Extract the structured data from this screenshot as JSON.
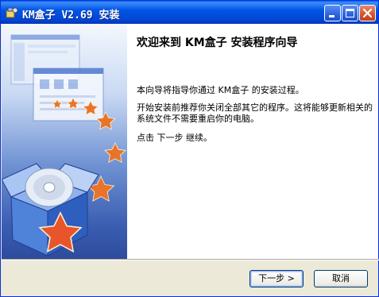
{
  "window": {
    "title": "KM盒子 V2.69 安装",
    "icon": "installer-icon"
  },
  "titlebar_buttons": {
    "minimize": "minimize-icon",
    "maximize": "maximize-icon",
    "close": "close-icon"
  },
  "content": {
    "heading": "欢迎来到 KM盒子 安装程序向导",
    "paragraph1": "本向导将指导你通过 KM盒子 的安装过程。",
    "paragraph2": "开始安装前推荐你关闭全部其它的程序。这将能够更新相关的系统文件不需要重启你的电脑。",
    "paragraph3": "点击 下一步 继续。"
  },
  "buttons": {
    "next": "下一步 >",
    "cancel": "取消"
  },
  "colors": {
    "titlebar": "#0155E5",
    "dialog": "#ECE9D8",
    "star": "#E8552A"
  }
}
